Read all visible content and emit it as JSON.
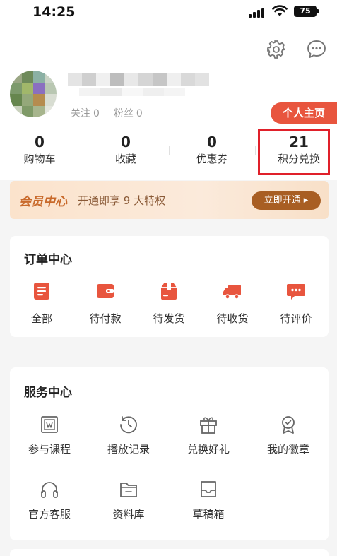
{
  "status_bar": {
    "time": "14:25",
    "battery": "75"
  },
  "header": {
    "settings_icon": "gear-icon",
    "message_icon": "chat-bubble-icon"
  },
  "profile": {
    "follow_label": "关注",
    "follow_count": "0",
    "fans_label": "粉丝",
    "fans_count": "0",
    "homepage_button": "个人主页"
  },
  "stats": [
    {
      "value": "0",
      "label": "购物车"
    },
    {
      "value": "0",
      "label": "收藏"
    },
    {
      "value": "0",
      "label": "优惠券"
    },
    {
      "value": "21",
      "label": "积分兑换"
    }
  ],
  "vip": {
    "title": "会员中心",
    "description": "开通即享 9 大特权",
    "button": "立即开通 ▸"
  },
  "orders": {
    "title": "订单中心",
    "items": [
      {
        "label": "全部",
        "icon": "document-icon"
      },
      {
        "label": "待付款",
        "icon": "wallet-icon"
      },
      {
        "label": "待发货",
        "icon": "package-icon"
      },
      {
        "label": "待收货",
        "icon": "truck-icon"
      },
      {
        "label": "待评价",
        "icon": "comment-icon"
      }
    ]
  },
  "services": {
    "title": "服务中心",
    "items": [
      {
        "label": "参与课程",
        "icon": "course-board-icon"
      },
      {
        "label": "播放记录",
        "icon": "clock-icon"
      },
      {
        "label": "兑换好礼",
        "icon": "gift-icon"
      },
      {
        "label": "我的徽章",
        "icon": "badge-icon"
      },
      {
        "label": "官方客服",
        "icon": "headset-icon"
      },
      {
        "label": "资料库",
        "icon": "folder-icon"
      },
      {
        "label": "草稿箱",
        "icon": "inbox-icon"
      }
    ]
  },
  "colors": {
    "accent": "#e8553e",
    "vip_text": "#c8692a",
    "vip_button": "#a85e23",
    "highlight_box": "#e0202a"
  }
}
